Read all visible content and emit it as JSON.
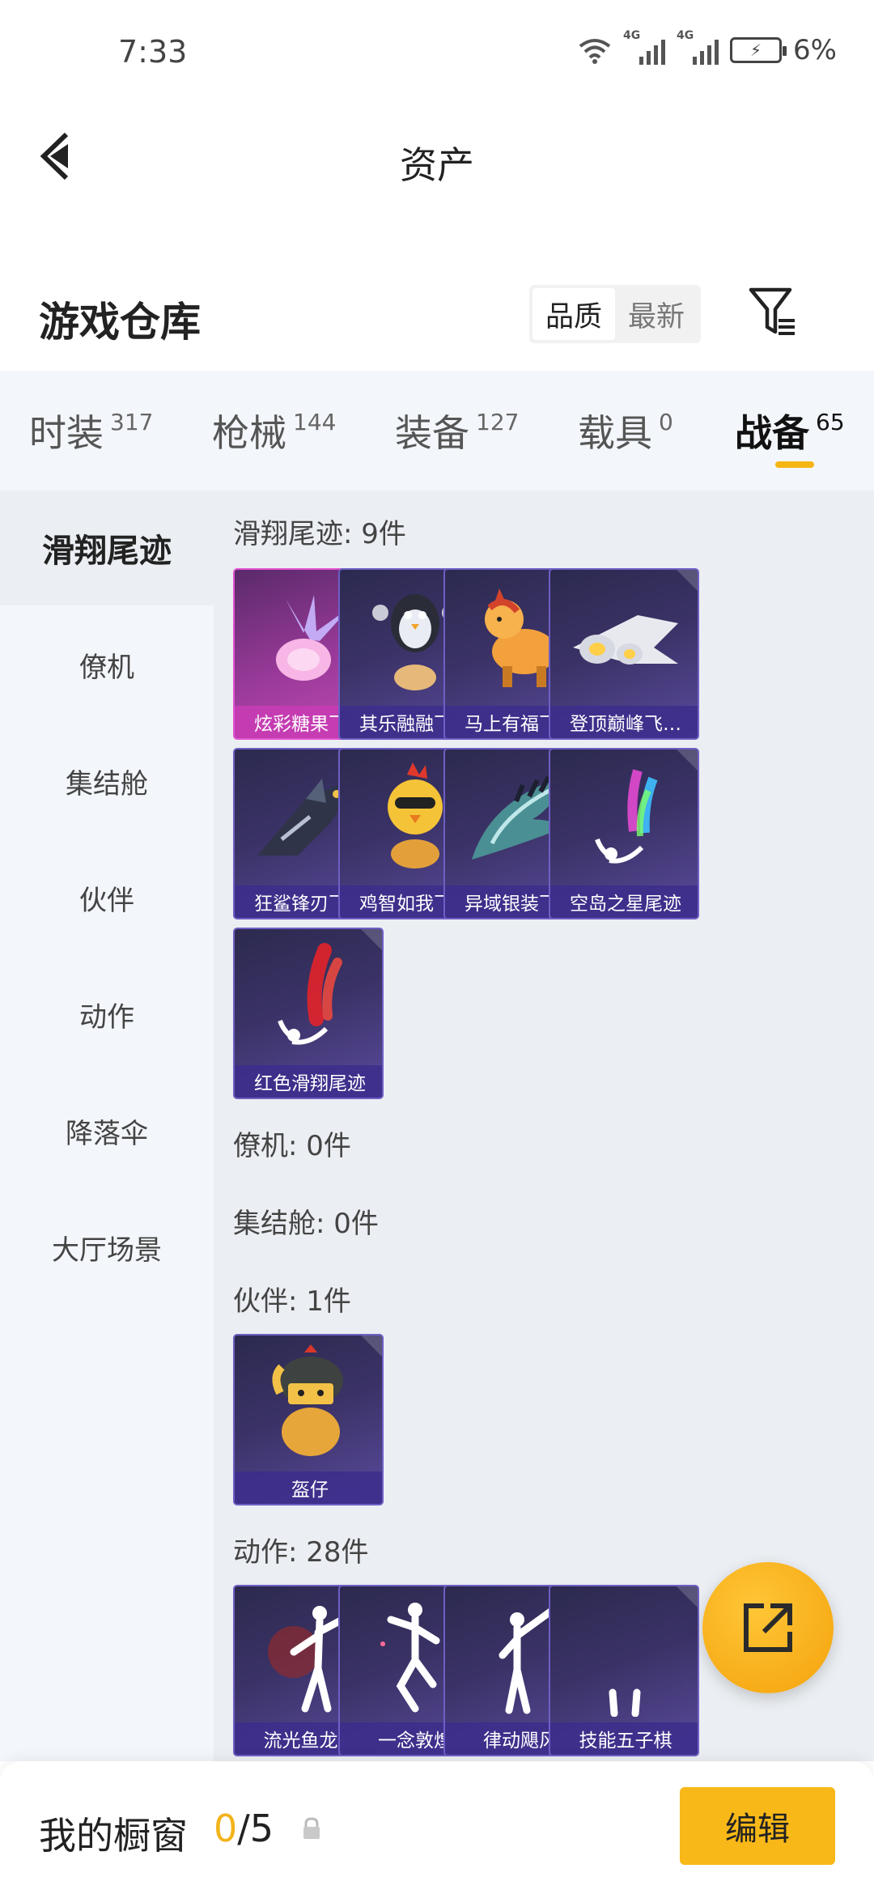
{
  "status": {
    "time": "7:33",
    "battery": "6%",
    "net1": "4G",
    "net2": "4G"
  },
  "header": {
    "title": "资产"
  },
  "repo": {
    "title": "游戏仓库",
    "sort_quality": "品质",
    "sort_newest": "最新"
  },
  "categories": [
    {
      "label": "时装",
      "count": "317"
    },
    {
      "label": "枪械",
      "count": "144"
    },
    {
      "label": "装备",
      "count": "127"
    },
    {
      "label": "载具",
      "count": "0"
    },
    {
      "label": "战备",
      "count": "65"
    }
  ],
  "sidebar": {
    "items": [
      {
        "label": "滑翔尾迹"
      },
      {
        "label": "僚机"
      },
      {
        "label": "集结舱"
      },
      {
        "label": "伙伴"
      },
      {
        "label": "动作"
      },
      {
        "label": "降落伞"
      },
      {
        "label": "大厅场景"
      }
    ]
  },
  "sections": {
    "glide": {
      "title": "滑翔尾迹: 9件",
      "items": [
        {
          "name": "炫彩糖果飞…"
        },
        {
          "name": "其乐融融飞…"
        },
        {
          "name": "马上有福飞…"
        },
        {
          "name": "登顶巅峰飞…"
        },
        {
          "name": "狂鲨锋刃飞…"
        },
        {
          "name": "鸡智如我飞…"
        },
        {
          "name": "异域银装飞…"
        },
        {
          "name": "空岛之星尾迹"
        },
        {
          "name": "红色滑翔尾迹"
        }
      ]
    },
    "wingman": {
      "title": "僚机: 0件"
    },
    "pod": {
      "title": "集结舱: 0件"
    },
    "partner": {
      "title": "伙伴: 1件",
      "items": [
        {
          "name": "盔仔"
        }
      ]
    },
    "action": {
      "title": "动作: 28件",
      "items": [
        {
          "name": "流光鱼龙舞"
        },
        {
          "name": "一念敦煌"
        },
        {
          "name": "律动飓风"
        },
        {
          "name": "技能五子棋"
        }
      ]
    }
  },
  "bottom": {
    "window_label": "我的橱窗",
    "window_current": "0",
    "window_total": "/5",
    "edit": "编辑"
  }
}
